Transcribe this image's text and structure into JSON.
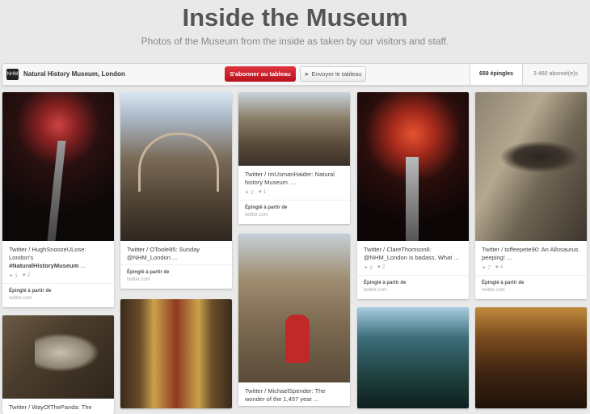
{
  "header": {
    "title": "Inside the Museum",
    "subtitle": "Photos of the Museum from the inside as taken by our visitors and staff."
  },
  "board_bar": {
    "avatar_text": "NHM",
    "owner": "Natural History Museum, London",
    "follow_label": "S'abonner au tableau",
    "send_label": "Envoyer le tableau",
    "pins_count": "659 épingles",
    "followers_count": "3 460 abonné(e)s"
  },
  "pins": [
    {
      "desc_line1": "Twitter / HughSnoozeULose:",
      "desc_line2": "London's",
      "desc_bold": "#NaturalHistoryMuseum",
      "desc_tail": " ...",
      "repins": "1",
      "likes": "2",
      "src_label": "Épinglé à partir de",
      "src_domain": "twitter.com"
    },
    {
      "desc": "Twitter / OToole85: Sunday @NHM_London ...",
      "src_label": "Épinglé à partir de",
      "src_domain": "twitter.com"
    },
    {
      "desc": "Twitter / ImUsmanHaider: Natural history Museum. ...",
      "repins": "2",
      "likes": "1",
      "src_label": "Épinglé à partir de",
      "src_domain": "twitter.com"
    },
    {
      "desc": "Twitter / ClareThomson6: @NHM_London is badass. What ...",
      "repins": "3",
      "likes": "2",
      "src_label": "Épinglé à partir de",
      "src_domain": "twitter.com"
    },
    {
      "desc": "Twitter / toffeepete90: An Allosaurus peeping! ...",
      "repins": "7",
      "likes": "4",
      "src_label": "Épinglé à partir de",
      "src_domain": "twitter.com"
    },
    {
      "desc": "Twitter / WayOfThePanda: The"
    },
    {
      "desc": "Twitter / MichaelSpender: The wonder of the 1,457 year ..."
    }
  ],
  "icons": {
    "repin": "pin-icon",
    "like": "heart-icon",
    "send": "send-icon"
  },
  "colors": {
    "follow_button": "#cb2027",
    "background": "#e9e9e9"
  }
}
